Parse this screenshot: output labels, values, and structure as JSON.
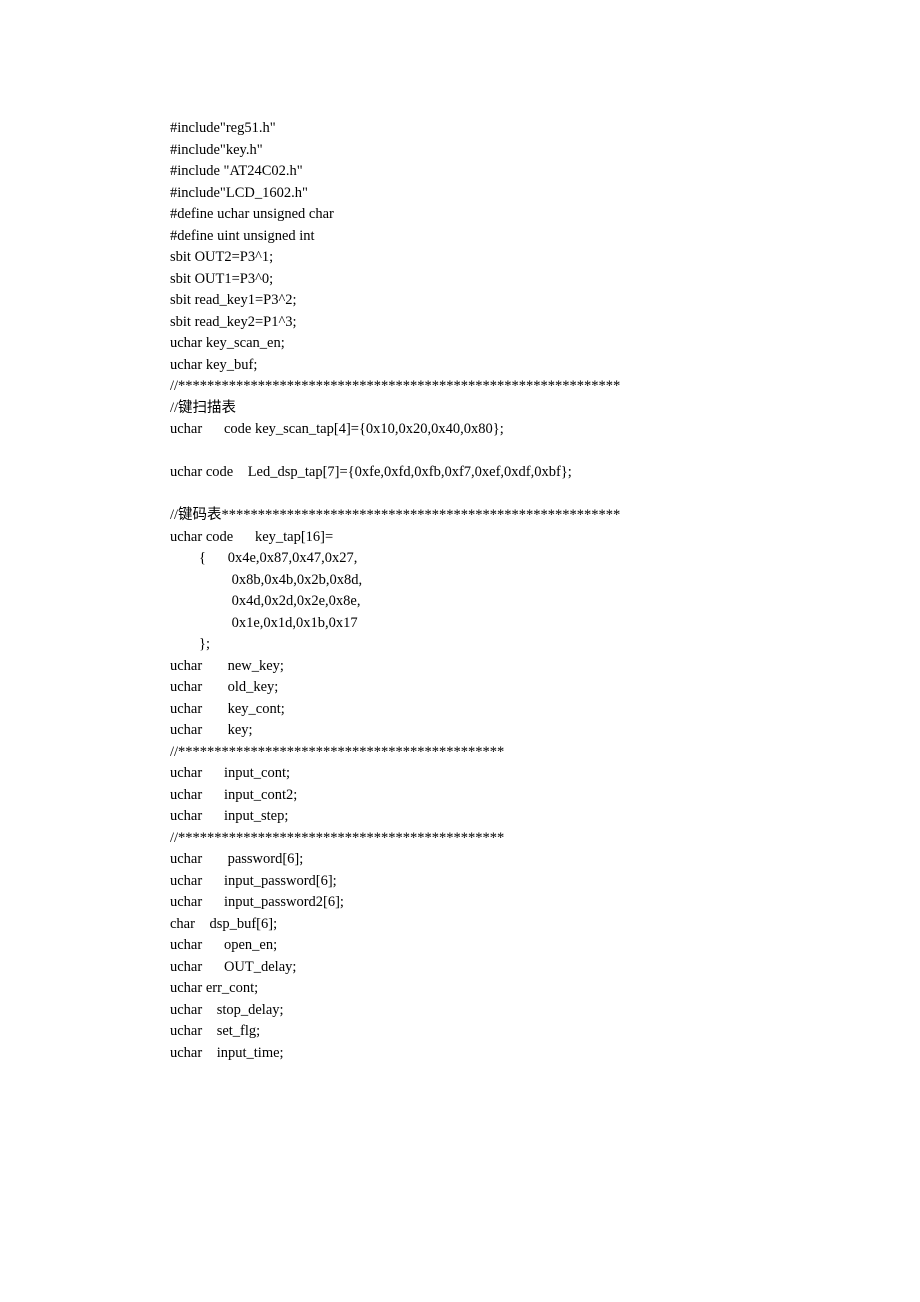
{
  "lines": [
    "#include\"reg51.h\"",
    "#include\"key.h\"",
    "#include \"AT24C02.h\"",
    "#include\"LCD_1602.h\"",
    "#define uchar unsigned char",
    "#define uint unsigned int",
    "sbit OUT2=P3^1;",
    "sbit OUT1=P3^0;",
    "sbit read_key1=P3^2;",
    "sbit read_key2=P1^3;",
    "uchar key_scan_en;",
    "uchar key_buf;",
    "//*************************************************************",
    "//键扫描表",
    "uchar      code key_scan_tap[4]={0x10,0x20,0x40,0x80};",
    "",
    "uchar code    Led_dsp_tap[7]={0xfe,0xfd,0xfb,0xf7,0xef,0xdf,0xbf};",
    "",
    "//键码表*******************************************************",
    "uchar code      key_tap[16]=",
    "        {      0x4e,0x87,0x47,0x27,",
    "                 0x8b,0x4b,0x2b,0x8d,",
    "                 0x4d,0x2d,0x2e,0x8e,",
    "                 0x1e,0x1d,0x1b,0x17",
    "        };",
    "uchar       new_key;",
    "uchar       old_key;",
    "uchar       key_cont;",
    "uchar       key;",
    "//*********************************************",
    "uchar      input_cont;",
    "uchar      input_cont2;",
    "uchar      input_step;",
    "//*********************************************",
    "uchar       password[6];",
    "uchar      input_password[6];",
    "uchar      input_password2[6];",
    "char    dsp_buf[6];",
    "uchar      open_en;",
    "uchar      OUT_delay;",
    "uchar err_cont;",
    "uchar    stop_delay;",
    "uchar    set_flg;",
    "uchar    input_time;"
  ]
}
